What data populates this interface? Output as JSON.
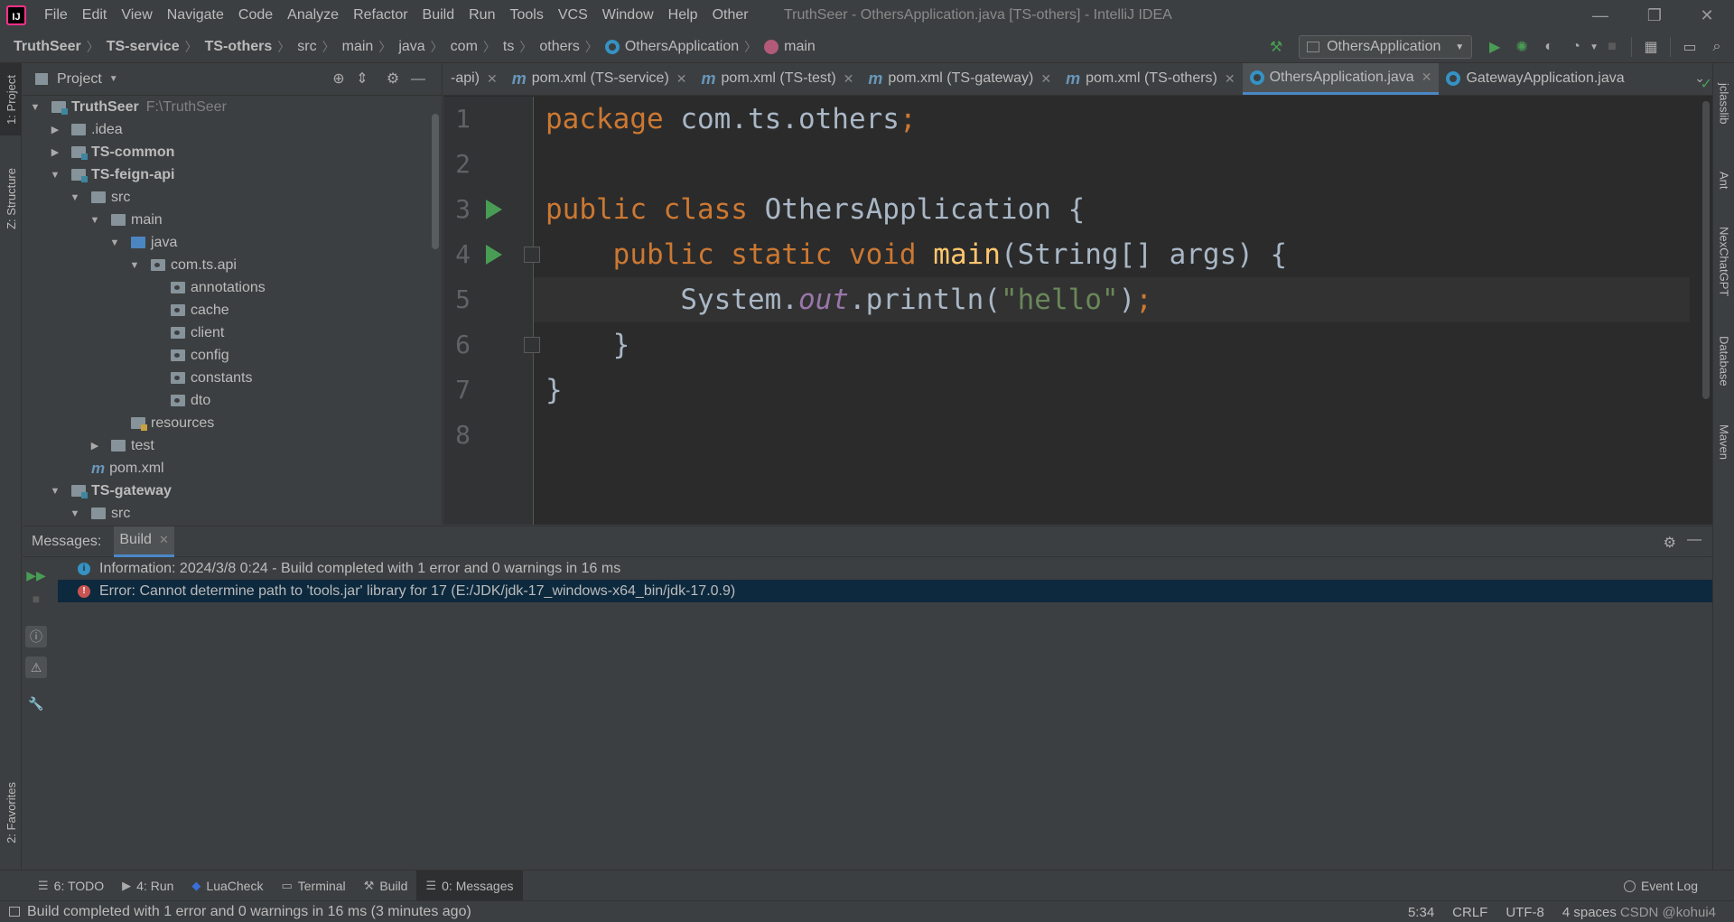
{
  "menubar": {
    "logo": "IJ",
    "items": [
      "File",
      "Edit",
      "View",
      "Navigate",
      "Code",
      "Analyze",
      "Refactor",
      "Build",
      "Run",
      "Tools",
      "VCS",
      "Window",
      "Help",
      "Other"
    ],
    "window_title": "TruthSeer - OthersApplication.java [TS-others] - IntelliJ IDEA"
  },
  "navbar": {
    "breadcrumbs": [
      "TruthSeer",
      "TS-service",
      "TS-others",
      "src",
      "main",
      "java",
      "com",
      "ts",
      "others",
      "OthersApplication",
      "main"
    ],
    "run_config": "OthersApplication"
  },
  "left_stripe": {
    "project_tab": "1: Project",
    "structure_tab": "Z: Structure",
    "favorites_tab": "2: Favorites"
  },
  "right_stripe": {
    "tabs": [
      "jclasslib",
      "Ant",
      "NexChatGPT",
      "Database",
      "Maven"
    ]
  },
  "project_panel": {
    "title": "Project",
    "tree": [
      {
        "label": "TruthSeer",
        "hint": "F:\\TruthSeer",
        "depth": 0,
        "arrow": "open",
        "icon": "module",
        "bold": true
      },
      {
        "label": ".idea",
        "depth": 1,
        "arrow": "closed",
        "icon": "folder"
      },
      {
        "label": "TS-common",
        "depth": 1,
        "arrow": "closed",
        "icon": "module",
        "bold": true
      },
      {
        "label": "TS-feign-api",
        "depth": 1,
        "arrow": "open",
        "icon": "module",
        "bold": true
      },
      {
        "label": "src",
        "depth": 2,
        "arrow": "open",
        "icon": "folder"
      },
      {
        "label": "main",
        "depth": 3,
        "arrow": "open",
        "icon": "folder"
      },
      {
        "label": "java",
        "depth": 4,
        "arrow": "open",
        "icon": "src"
      },
      {
        "label": "com.ts.api",
        "depth": 5,
        "arrow": "open",
        "icon": "pkg"
      },
      {
        "label": "annotations",
        "depth": 6,
        "icon": "pkg"
      },
      {
        "label": "cache",
        "depth": 6,
        "icon": "pkg"
      },
      {
        "label": "client",
        "depth": 6,
        "icon": "pkg"
      },
      {
        "label": "config",
        "depth": 6,
        "icon": "pkg"
      },
      {
        "label": "constants",
        "depth": 6,
        "icon": "pkg"
      },
      {
        "label": "dto",
        "depth": 6,
        "icon": "pkg"
      },
      {
        "label": "resources",
        "depth": 4,
        "icon": "res"
      },
      {
        "label": "test",
        "depth": 3,
        "arrow": "closed",
        "icon": "folder"
      },
      {
        "label": "pom.xml",
        "depth": 2,
        "icon": "maven"
      },
      {
        "label": "TS-gateway",
        "depth": 1,
        "arrow": "open",
        "icon": "module",
        "bold": true
      },
      {
        "label": "src",
        "depth": 2,
        "arrow": "open",
        "icon": "folder"
      }
    ]
  },
  "editor": {
    "tabs": [
      {
        "label": "-api)",
        "icon": "none"
      },
      {
        "label": "pom.xml (TS-service)",
        "icon": "maven"
      },
      {
        "label": "pom.xml (TS-test)",
        "icon": "maven"
      },
      {
        "label": "pom.xml (TS-gateway)",
        "icon": "maven"
      },
      {
        "label": "pom.xml (TS-others)",
        "icon": "maven"
      },
      {
        "label": "OthersApplication.java",
        "icon": "class",
        "active": true
      },
      {
        "label": "GatewayApplication.java",
        "icon": "class"
      }
    ],
    "line_numbers": [
      "1",
      "2",
      "3",
      "4",
      "5",
      "6",
      "7",
      "8"
    ],
    "code": {
      "line1": {
        "kw": "package",
        "rest": " com.ts.others",
        "semi": ";"
      },
      "line3": {
        "kw": "public class",
        "rest": " OthersApplication {"
      },
      "line4": {
        "kw": "public static void",
        "fn": "main",
        "rest": "(String[] args) {"
      },
      "line5": {
        "obj": "System.",
        "field": "out",
        "call": ".println(",
        "str": "\"hello\"",
        "end": ")",
        "semi": ";"
      },
      "line6": "}",
      "line7": "}"
    },
    "caret_line": 5
  },
  "messages": {
    "label": "Messages:",
    "tab": "Build",
    "rows": [
      {
        "type": "info",
        "text": "Information: 2024/3/8 0:24 - Build completed with 1 error and 0 warnings in 16 ms"
      },
      {
        "type": "error",
        "text": "Error: Cannot determine path to 'tools.jar' library for 17 (E:/JDK/jdk-17_windows-x64_bin/jdk-17.0.9)",
        "selected": true
      }
    ]
  },
  "bottom_bar": {
    "tabs": [
      {
        "label": "6: TODO",
        "icon": "☰"
      },
      {
        "label": "4: Run",
        "icon": "▶"
      },
      {
        "label": "LuaCheck",
        "icon": "◆"
      },
      {
        "label": "Terminal",
        "icon": "▭"
      },
      {
        "label": "Build",
        "icon": "⚒"
      },
      {
        "label": "0: Messages",
        "icon": "☰",
        "active": true
      }
    ],
    "event_log": "Event Log"
  },
  "status_bar": {
    "text": "Build completed with 1 error and 0 warnings in 16 ms (3 minutes ago)",
    "position": "5:34",
    "line_sep": "CRLF",
    "encoding": "UTF-8",
    "indent": "4 spaces",
    "watermark": "CSDN @kohui4"
  },
  "colors": {
    "accent": "#4a88c7",
    "run_green": "#499c54",
    "error_red": "#c75450",
    "info_blue": "#3592c4",
    "keyword": "#cc7832",
    "function": "#ffc66d",
    "string": "#6a8759",
    "static_field": "#9876aa"
  }
}
